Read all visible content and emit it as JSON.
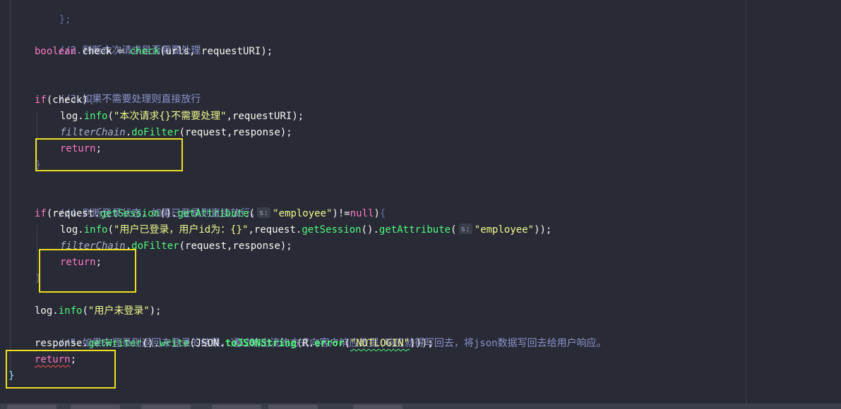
{
  "editor": {
    "lines": {
      "l0": "};",
      "c2": "//2.判断本次请求是否需要处理",
      "l_check_kw": "boolean",
      "l_check_var": " check = ",
      "l_check_fn": "check",
      "l_check_args": "(urls, requestURI);",
      "c3": "//3.如果不需要处理则直接放行",
      "if1_kw": "if",
      "if1_rest": "(check)",
      "if1_brace": "{",
      "log": "log",
      "dot": ".",
      "info": "info",
      "log1_str": "\"本次请求{}不需要处理\"",
      "log1_rest": ",requestURI);",
      "filterChain": "filterChain",
      "doFilter": "doFilter",
      "doFilter_args": "(request,response);",
      "return_kw": "return",
      "semicolon": ";",
      "close_brace": "}",
      "c4": "//4.判断登录状态，如果已登录则直接放行。",
      "if2_kw": "if",
      "if2_a": "(request.",
      "getSession": "getSession",
      "if2_b": "().",
      "getAttribute": "getAttribute",
      "hint_s": "s:",
      "employee_str": "\"employee\"",
      "if2_c": ")!=",
      "null_kw": "null",
      "if2_d": ")",
      "log2_str": "\"用户已登录，用户id为：{}\"",
      "log2_a": ",request.",
      "log2_b": "().",
      "log2_c": "));",
      "log3_str": "\"用户未登录\"",
      "log3_rest": ");",
      "c5": "//5.如果未登录则返回未登录的结果，通过输出流的方式向客户响应数据(响应就得写回去，将json数据写回去给用户响应。",
      "response": "response.",
      "getWriter": "getWriter",
      "w_a": "().",
      "write": "write",
      "w_b": "(",
      "json_cls": "JSON",
      "toJSONString": "toJSONString",
      "R_cls": "R",
      "error_fn": "error",
      "notlogin_str": "\"NOTLOGIN\"",
      "w_c": ")));",
      "open_paren": "("
    }
  },
  "colors": {
    "background": "#282a36",
    "highlight_box": "#f0e020",
    "keyword": "#ff79c6",
    "comment": "#8b93c9",
    "string": "#f1fa8c",
    "function": "#50fa7b"
  }
}
